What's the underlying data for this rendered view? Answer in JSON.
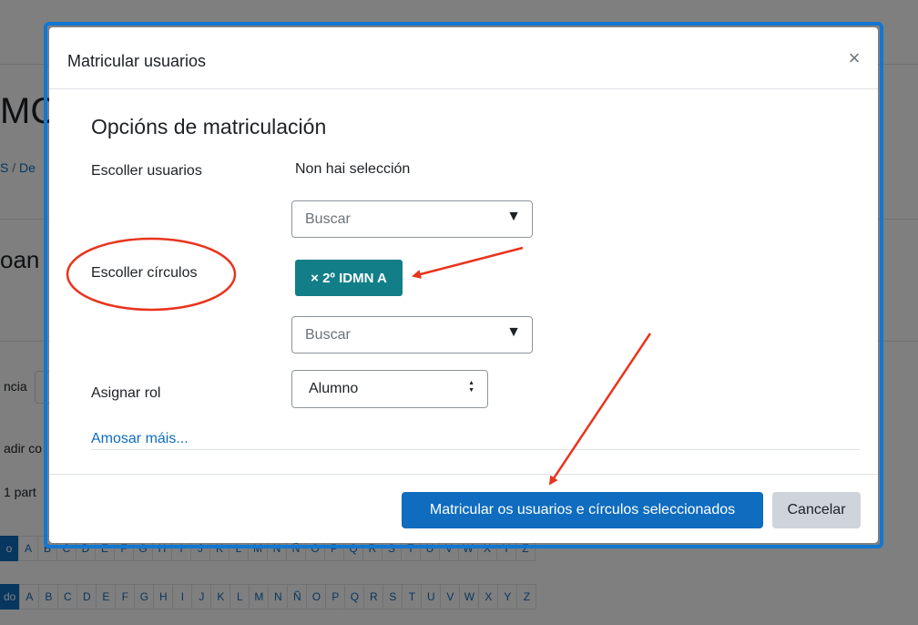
{
  "background": {
    "heading_fragment": "MCI",
    "breadcrumb_fragment": "S",
    "breadcrumb_separator": "/",
    "breadcrumb_fragment2": "De",
    "subheading_fragment": "oan",
    "filter_label_fragment": "ncia",
    "add_label_fragment": "adir co",
    "parts_label_fragment": "1 part",
    "letters_row1": [
      "o",
      "A",
      "B",
      "C",
      "D",
      "E",
      "F",
      "G",
      "H",
      "I",
      "J",
      "K",
      "L",
      "M",
      "N",
      "Ñ",
      "O",
      "P",
      "Q",
      "R",
      "S",
      "T",
      "U",
      "V",
      "W",
      "X",
      "Y",
      "Z"
    ],
    "letters_row2": [
      "do",
      "A",
      "B",
      "C",
      "D",
      "E",
      "F",
      "G",
      "H",
      "I",
      "J",
      "K",
      "L",
      "M",
      "N",
      "Ñ",
      "O",
      "P",
      "Q",
      "R",
      "S",
      "T",
      "U",
      "V",
      "W",
      "X",
      "Y",
      "Z"
    ]
  },
  "modal": {
    "title": "Matricular usuarios",
    "close_glyph": "×",
    "section_title": "Opcións de matriculación",
    "users": {
      "label": "Escoller usuarios",
      "value": "Non hai selección",
      "search_placeholder": "Buscar"
    },
    "cohorts": {
      "label": "Escoller círculos",
      "selected_tag": "× 2º IDMN A",
      "search_placeholder": "Buscar"
    },
    "role": {
      "label": "Asignar rol",
      "selected": "Alumno"
    },
    "show_more": "Amosar máis...",
    "submit_button": "Matricular os usuarios e círculos seleccionados",
    "cancel_button": "Cancelar"
  },
  "icons": {
    "dropdown": "▼",
    "select_arrows_up": "▲",
    "select_arrows_down": "▼"
  },
  "colors": {
    "primary": "#0f6cbf",
    "tag": "#127e88",
    "annotation": "#e8341c",
    "modal_border": "#1177d1"
  }
}
